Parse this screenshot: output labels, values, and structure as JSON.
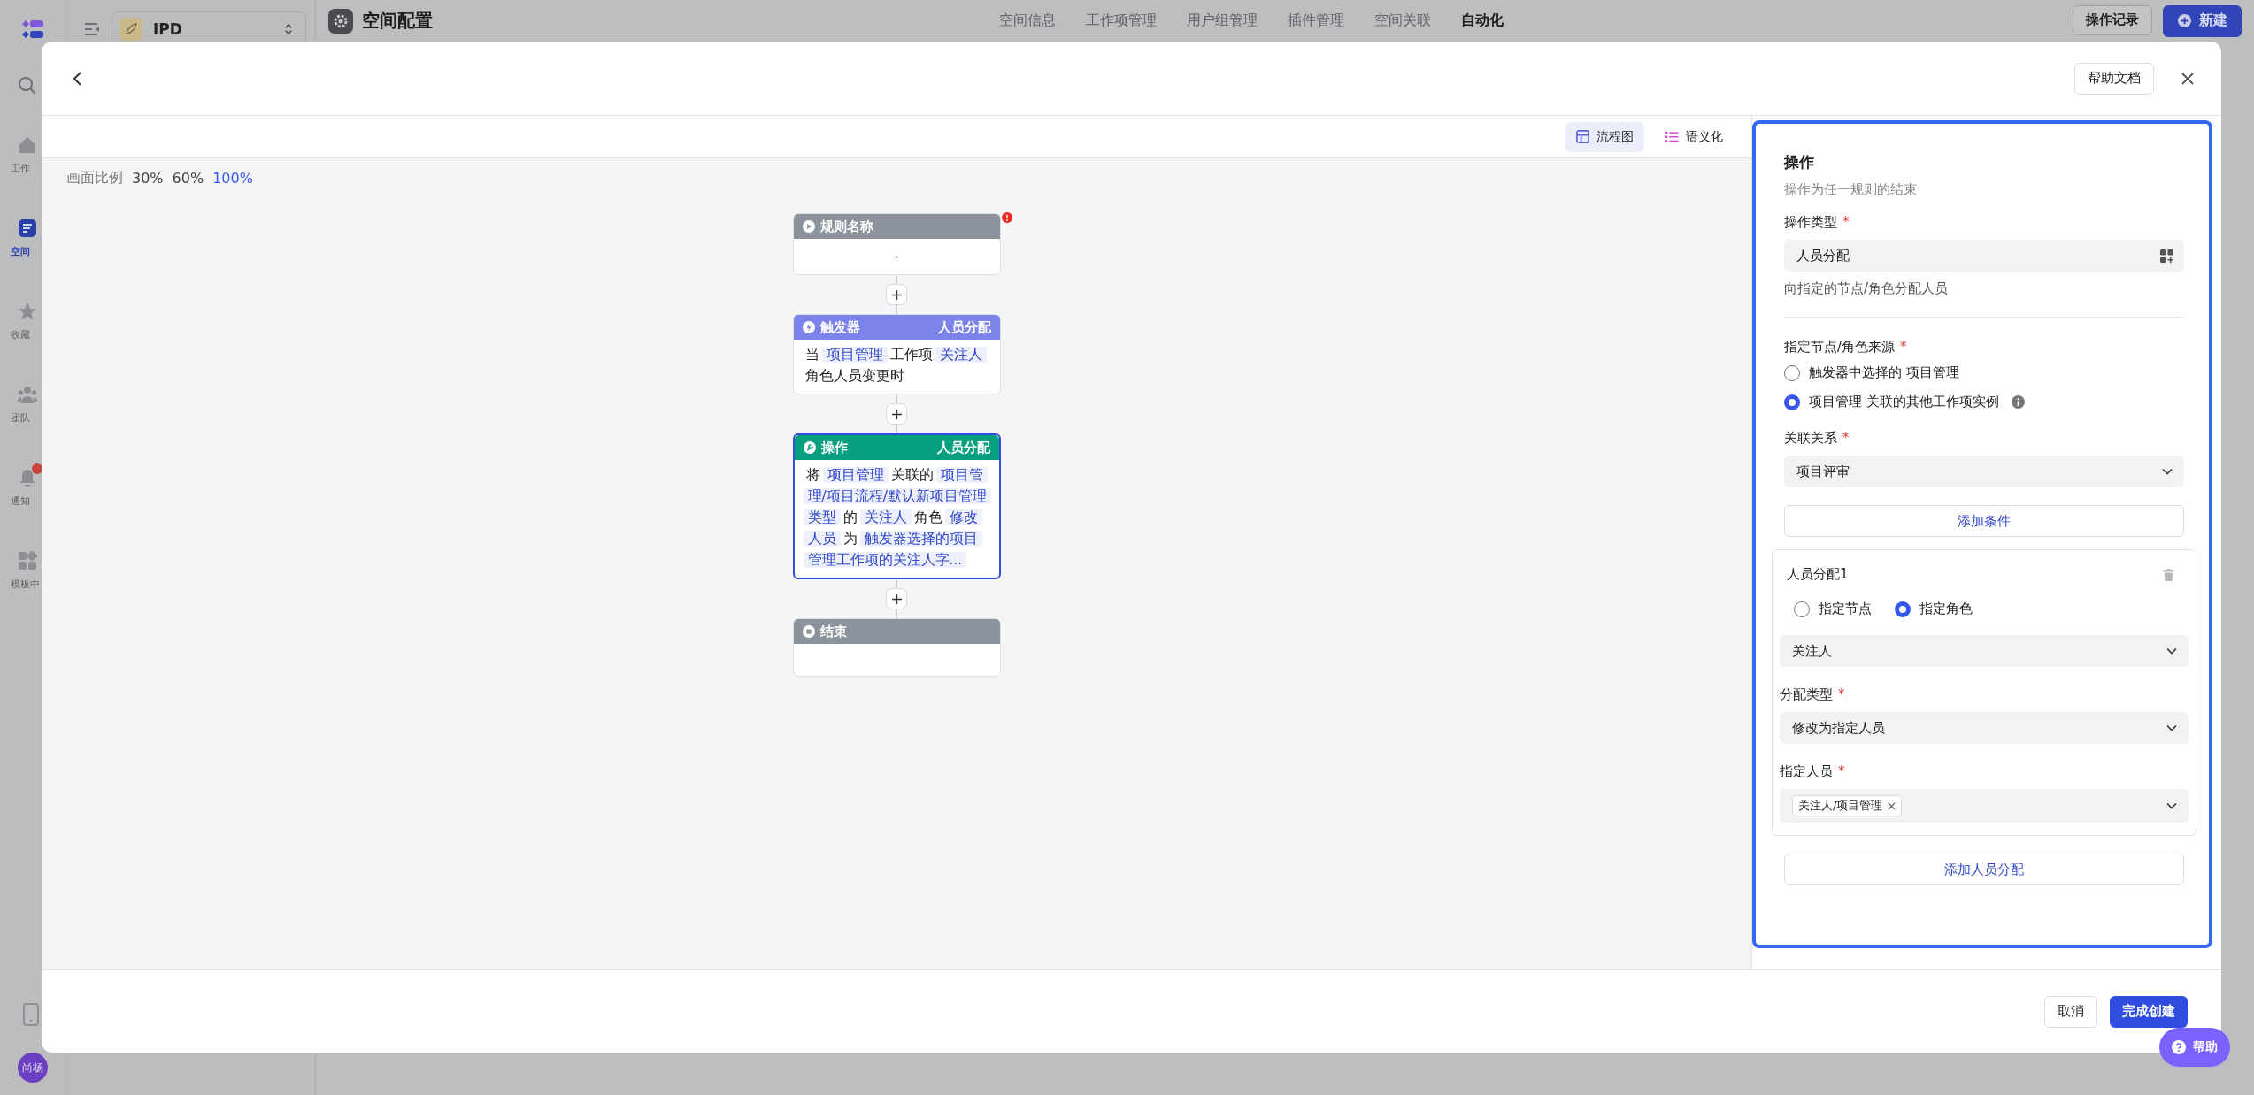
{
  "app_nav": {
    "items": [
      {
        "label": "工作",
        "selected": false,
        "badge": false
      },
      {
        "label": "空间",
        "selected": true,
        "badge": false
      },
      {
        "label": "收藏",
        "selected": false,
        "badge": false
      },
      {
        "label": "团队",
        "selected": false,
        "badge": false
      },
      {
        "label": "通知",
        "selected": false,
        "badge": true
      },
      {
        "label": "模板中",
        "selected": false,
        "badge": false
      }
    ],
    "avatar": "尚杨"
  },
  "space_selector": {
    "name": "IPD"
  },
  "header": {
    "title": "空间配置",
    "tabs": [
      {
        "label": "空间信息",
        "selected": false
      },
      {
        "label": "工作项管理",
        "selected": false
      },
      {
        "label": "用户组管理",
        "selected": false
      },
      {
        "label": "插件管理",
        "selected": false
      },
      {
        "label": "空间关联",
        "selected": false
      },
      {
        "label": "自动化",
        "selected": true
      }
    ],
    "history_button": "操作记录",
    "new_button": "新建"
  },
  "modal": {
    "help_doc_button": "帮助文档",
    "view_tabs": [
      {
        "label": "流程图",
        "selected": true
      },
      {
        "label": "语义化",
        "selected": false
      }
    ],
    "zoom": {
      "label": "画面比例",
      "options": [
        {
          "label": "30%",
          "selected": false
        },
        {
          "label": "60%",
          "selected": false
        },
        {
          "label": "100%",
          "selected": true
        }
      ]
    },
    "flow_nodes": [
      {
        "kind": "start",
        "title": "规则名称",
        "error": true,
        "selected": false,
        "body": [
          {
            "text": "-",
            "tag": false
          }
        ]
      },
      {
        "kind": "trigger",
        "title": "触发器",
        "subtitle": "人员分配",
        "error": false,
        "selected": false,
        "body": [
          {
            "text": "当",
            "tag": false
          },
          {
            "text": "项目管理",
            "tag": true
          },
          {
            "text": "工作项",
            "tag": false
          },
          {
            "text": "关注人",
            "tag": true
          },
          {
            "text": "角色人员变更时",
            "tag": false
          }
        ]
      },
      {
        "kind": "action",
        "title": "操作",
        "subtitle": "人员分配",
        "error": false,
        "selected": true,
        "body": [
          {
            "text": "将",
            "tag": false
          },
          {
            "text": "项目管理",
            "tag": true
          },
          {
            "text": "关联的",
            "tag": false
          },
          {
            "text": "项目管理/项目流程/默认新项目管理类型",
            "tag": true
          },
          {
            "text": "的",
            "tag": false
          },
          {
            "text": "关注人",
            "tag": true
          },
          {
            "text": "角色",
            "tag": false
          },
          {
            "text": "修改人员",
            "tag": true
          },
          {
            "text": "为",
            "tag": false
          },
          {
            "text": "触发器选择的项目管理工作项的关注人字...",
            "tag": true
          }
        ]
      },
      {
        "kind": "end",
        "title": "结束",
        "error": false,
        "selected": false
      }
    ],
    "panel": {
      "title": "操作",
      "subtitle": "操作为任一规则的结束",
      "action_type": {
        "label": "操作类型",
        "required_mark": "*",
        "value": "人员分配",
        "hint": "向指定的节点/角色分配人员"
      },
      "source": {
        "label": "指定节点/角色来源",
        "required_mark": "*",
        "options": [
          {
            "label": "触发器中选择的 项目管理",
            "selected": false,
            "info": false
          },
          {
            "label": "项目管理 关联的其他工作项实例",
            "selected": true,
            "info": true
          }
        ]
      },
      "relation": {
        "label": "关联关系",
        "required_mark": "*",
        "value": "项目评审"
      },
      "add_condition_button": "添加条件",
      "assignment": {
        "title": "人员分配1",
        "target_options": [
          {
            "label": "指定节点",
            "selected": false
          },
          {
            "label": "指定角色",
            "selected": true
          }
        ],
        "role_value": "关注人",
        "assign_type": {
          "label": "分配类型",
          "required_mark": "*",
          "value": "修改为指定人员"
        },
        "people": {
          "label": "指定人员",
          "required_mark": "*",
          "chips": [
            "关注人/项目管理"
          ]
        }
      },
      "add_assignment_button": "添加人员分配"
    },
    "footer": {
      "cancel_button": "取消",
      "submit_button": "完成创建"
    }
  },
  "help_button": "帮助"
}
